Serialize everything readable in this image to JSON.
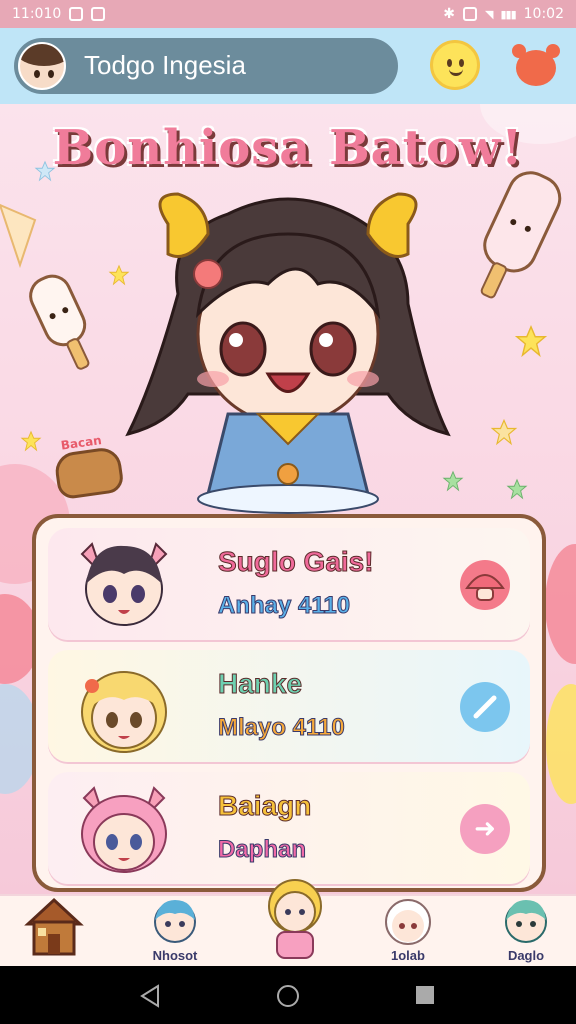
{
  "status_bar": {
    "time_left": "11:010",
    "time_right": "10:02"
  },
  "header": {
    "username": "Todgo Ingesia"
  },
  "banner": {
    "title": "Bonhiosa Batow!"
  },
  "sticker": {
    "text": "Bacan"
  },
  "list": [
    {
      "title": "Suglo Gais!",
      "subtitle": "Anhay 4110",
      "title_color": "#f06a9a",
      "subtitle_color": "#5ab0e8",
      "action_icon": "mushroom-icon",
      "action_color": "#f47a8a"
    },
    {
      "title": "Hanke",
      "subtitle": "Mlayo 4110",
      "title_color": "#6ed0b0",
      "subtitle_color": "#f6a93a",
      "action_icon": "pencil-icon",
      "action_color": "#7cc6ee"
    },
    {
      "title": "Baiagn",
      "subtitle": "Daphan",
      "title_color": "#f6c13a",
      "subtitle_color": "#f06aa8",
      "action_icon": "arrow-right-icon",
      "action_color": "#f5a0c0"
    }
  ],
  "bottom_nav": [
    {
      "label": "",
      "icon": "house-icon"
    },
    {
      "label": "Nhosot",
      "icon": "avatar-blue-icon"
    },
    {
      "label": "",
      "icon": "avatar-blonde-icon"
    },
    {
      "label": "1olab",
      "icon": "avatar-white-icon"
    },
    {
      "label": "Daglo",
      "icon": "avatar-teal-icon"
    }
  ],
  "colors": {
    "accent": "#f07c9a",
    "header_bg": "#bfe5f7",
    "card_border": "#8a5a3a"
  }
}
